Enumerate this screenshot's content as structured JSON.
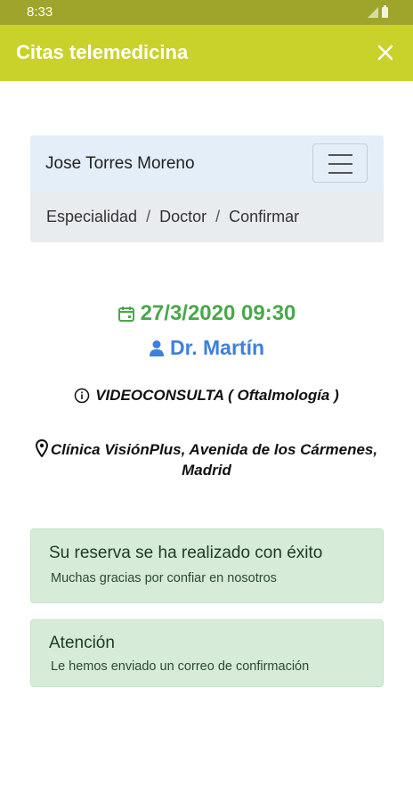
{
  "status_bar": {
    "time": "8:33"
  },
  "app_bar": {
    "title": "Citas telemedicina"
  },
  "header": {
    "user_name": "Jose Torres Moreno"
  },
  "breadcrumb": {
    "items": [
      "Especialidad",
      "Doctor",
      "Confirmar"
    ]
  },
  "appointment": {
    "datetime": "27/3/2020 09:30",
    "doctor": "Dr. Martín",
    "type": "VIDEOCONSULTA ( Oftalmología )",
    "location_line1": "Clínica VisiónPlus, Avenida de los Cármenes,",
    "location_line2": "Madrid"
  },
  "alerts": [
    {
      "title": "Su reserva se ha realizado con éxito",
      "text": "Muchas gracias por confiar en nosotros"
    },
    {
      "title": "Atención",
      "text": "Le hemos enviado un correo de confirmación"
    }
  ],
  "colors": {
    "app_bar": "#c9d22b",
    "status_bar": "#9fa52a",
    "date_green": "#4aa84a",
    "doctor_blue": "#3e7fe0",
    "alert_bg": "#d6ecd8"
  },
  "icons": [
    "signal-icon",
    "battery-icon",
    "close-icon",
    "menu-icon",
    "calendar-icon",
    "person-icon",
    "info-icon",
    "location-pin-icon"
  ]
}
